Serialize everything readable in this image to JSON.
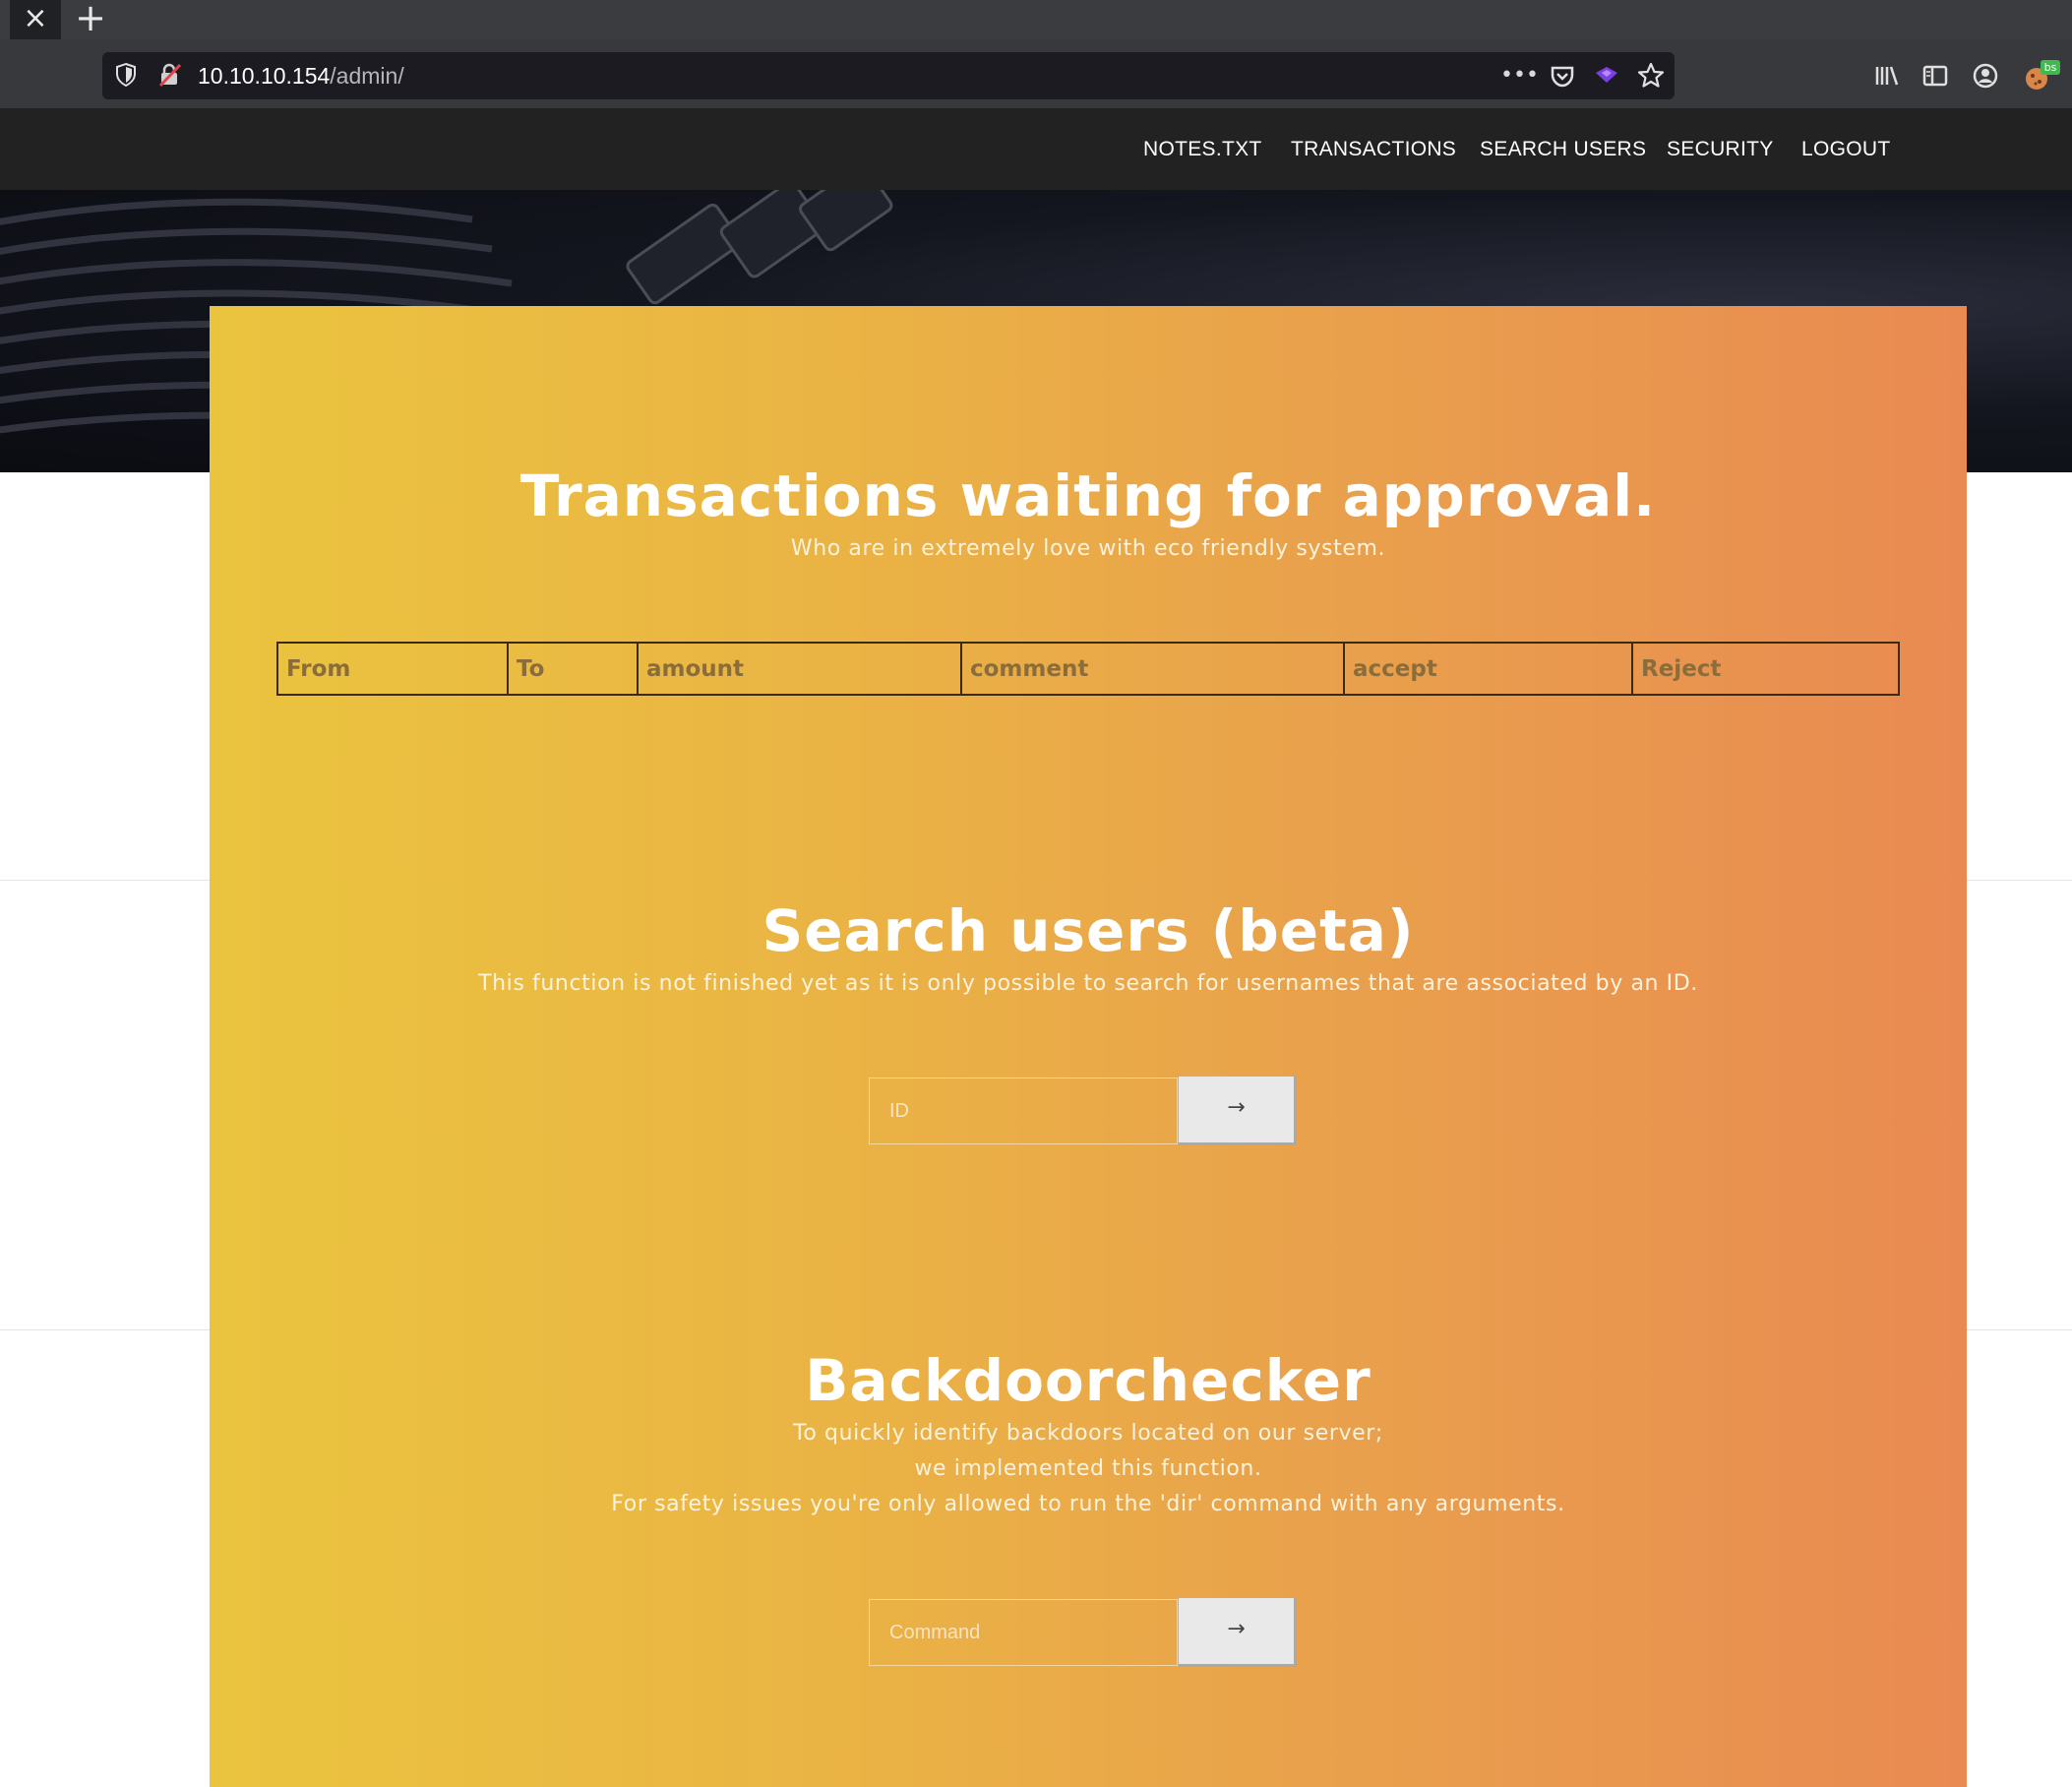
{
  "browser": {
    "close_tab_glyph": "×",
    "new_tab_glyph": "+",
    "url_host": "10.10.10.154",
    "url_path": "/admin/",
    "page_actions_glyph": "•••",
    "extension_badge": "bs"
  },
  "site_nav": {
    "items": [
      "NOTES.TXT",
      "TRANSACTIONS",
      "SEARCH USERS",
      "SECURITY",
      "LOGOUT"
    ]
  },
  "transactions": {
    "title": "Transactions waiting for approval.",
    "subtitle": "Who are in extremely love with eco friendly system.",
    "columns": [
      "From",
      "To",
      "amount",
      "comment",
      "accept",
      "Reject"
    ]
  },
  "search_users": {
    "title": "Search users (beta)",
    "subtitle": "This function is not finished yet as it is only possible to search for usernames that are associated by an ID.",
    "placeholder": "ID",
    "button_glyph": "→"
  },
  "backdoorchecker": {
    "title": "Backdoorchecker",
    "lines": [
      "To quickly identify backdoors located on our server;",
      "we implemented this function.",
      "For safety issues you're only allowed to run the 'dir' command with any arguments."
    ],
    "placeholder": "Command",
    "button_glyph": "→"
  }
}
